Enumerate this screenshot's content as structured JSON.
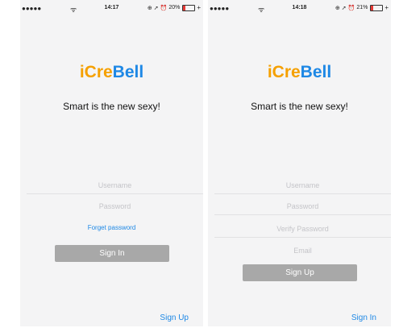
{
  "left_screen": {
    "status": {
      "signal": "●●●●●",
      "wifi": "ᯤ",
      "time": "14:17",
      "battery": "20%",
      "battery_level": 0.2
    },
    "logo": {
      "part1": "iCre",
      "part2": "Bell"
    },
    "tagline": "Smart is the new sexy!",
    "fields": {
      "username_placeholder": "Username",
      "password_placeholder": "Password"
    },
    "forget_password": "Forget password",
    "sign_in_button": "Sign In",
    "bottom_link": "Sign Up"
  },
  "right_screen": {
    "status": {
      "signal": "●●●●●",
      "wifi": "ᯤ",
      "time": "14:18",
      "battery": "21%",
      "battery_level": 0.21
    },
    "logo": {
      "part1": "iCre",
      "part2": "Bell"
    },
    "tagline": "Smart is the new sexy!",
    "fields": {
      "username_placeholder": "Username",
      "password_placeholder": "Password",
      "verify_password_placeholder": "Verify Password",
      "email_placeholder": "Email"
    },
    "sign_up_button": "Sign Up",
    "bottom_link": "Sign In"
  },
  "colors": {
    "logo_orange": "#f5a000",
    "logo_blue": "#1e88e5",
    "link_blue": "#1e88e5",
    "button_gray": "#a8a8a8"
  }
}
